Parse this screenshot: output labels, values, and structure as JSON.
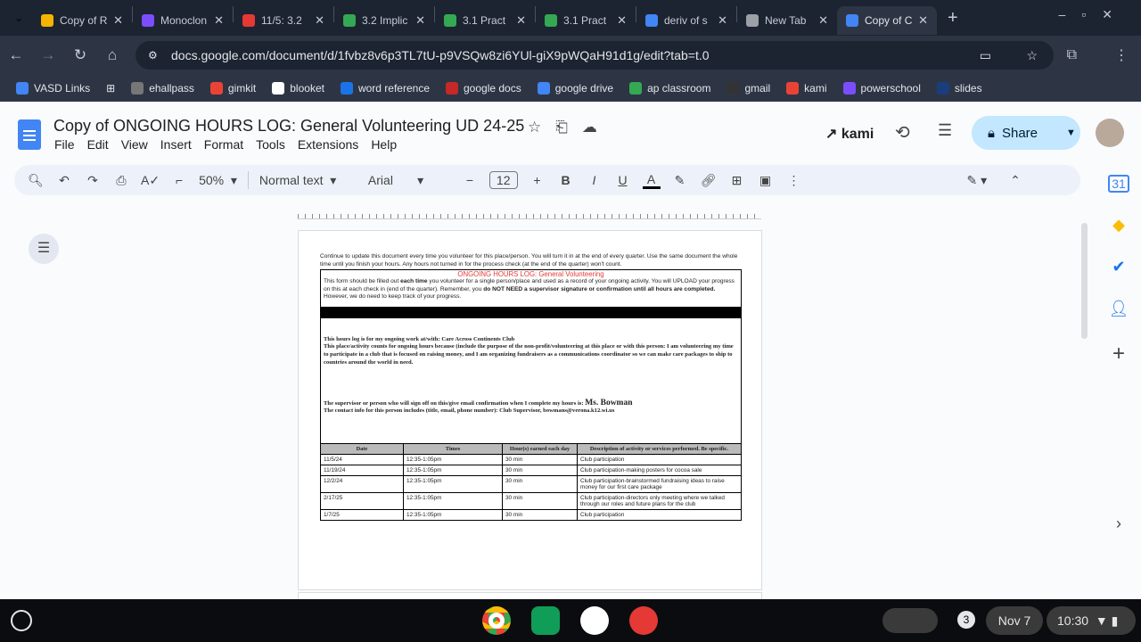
{
  "tabs": [
    {
      "title": "Copy of R",
      "color": "#f4b400"
    },
    {
      "title": "Monoclon",
      "color": "#7c4dff"
    },
    {
      "title": "11/5: 3.2",
      "color": "#e53935"
    },
    {
      "title": "3.2 Implic",
      "color": "#34a853"
    },
    {
      "title": "3.1 Pract",
      "color": "#34a853"
    },
    {
      "title": "3.1 Pract",
      "color": "#34a853"
    },
    {
      "title": "deriv of s",
      "color": "#4285f4"
    },
    {
      "title": "New Tab",
      "color": "#9aa0a6"
    },
    {
      "title": "Copy of C",
      "color": "#4285f4"
    }
  ],
  "url": "docs.google.com/document/d/1fvbz8v6p3TL7tU-p9VSQw8zi6YUl-giX9pWQaH91d1g/edit?tab=t.0",
  "bookmarks": [
    "VASD Links",
    "ehallpass",
    "gimkit",
    "blooket",
    "word reference",
    "google docs",
    "google drive",
    "ap classroom",
    "gmail",
    "kami",
    "powerschool",
    "slides"
  ],
  "doc": {
    "title": "Copy of ONGOING HOURS LOG: General Volunteering UD 24-25",
    "menus": [
      "File",
      "Edit",
      "View",
      "Insert",
      "Format",
      "Tools",
      "Extensions",
      "Help"
    ],
    "kami": "kami",
    "share": "Share",
    "zoom": "50%",
    "style": "Normal text",
    "font": "Arial",
    "size": "12"
  },
  "page": {
    "intro": "Continue to update this document every time you volunteer for this place/person. You will turn it in at the end of every quarter. Use the same document the whole time until you finish your hours. Any hours not turned in for the process check (at the end of the quarter) won't count.",
    "heading": "ONGOING HOURS LOG: General Volunteering",
    "p1a": "This form should be filled out ",
    "p1b": "each time",
    "p1c": " you volunteer for a single person/place and used as a record of your ongoing activity. You will UPLOAD your progress on this at each check in (end of the quarter). Remember, you ",
    "p1d": "do NOT NEED a supervisor signature or confirmation until all hours are completed.",
    "p1e": " However, we do need to keep track of your progress.",
    "work": "This hours log is for my ongoing work at/with: Care Across Continents Club",
    "purpose": "This place/activity counts for ongoing hours because (include the purpose of the non-profit/volunteering at this place or with this person: I am volunteering my time to participate in a club that is focused on raising money, and I am organizing fundraisers as a communications coordinator so we can make care packages to ship to countries around the world in need.",
    "supervisor_label": "The supervisor or person who will sign off on this/give email confirmation when I complete my hours is: ",
    "supervisor": "Ms. Bowman",
    "contact": "The contact info for this person includes (title, email, phone number): Club Supervisor, bowmans@verona.k12.wi.us",
    "headers": [
      "Date",
      "Times",
      "Hour(s) earned each day",
      "Description of activity or services performed. Be specific."
    ],
    "rows": [
      [
        "11/5/24",
        "12:35-1:05pm",
        "30 min",
        "Club participation"
      ],
      [
        "11/19/24",
        "12:35-1:05pm",
        "30 min",
        "Club participation-making posters for cocoa sale"
      ],
      [
        "12/2/24",
        "12:35-1:05pm",
        "30 min",
        "Club participation-brainstormed fundraising ideas to raise money for our first care package"
      ],
      [
        "2/17/25",
        "12:35-1:05pm",
        "30 min",
        "Club participation-directors only meeting where we talked through our roles and future plans for the club"
      ],
      [
        "1/7/25",
        "12:35-1:05pm",
        "30 min",
        "Club participation"
      ]
    ]
  },
  "shelf": {
    "date": "Nov 7",
    "time": "10:30",
    "notifications": "3"
  }
}
